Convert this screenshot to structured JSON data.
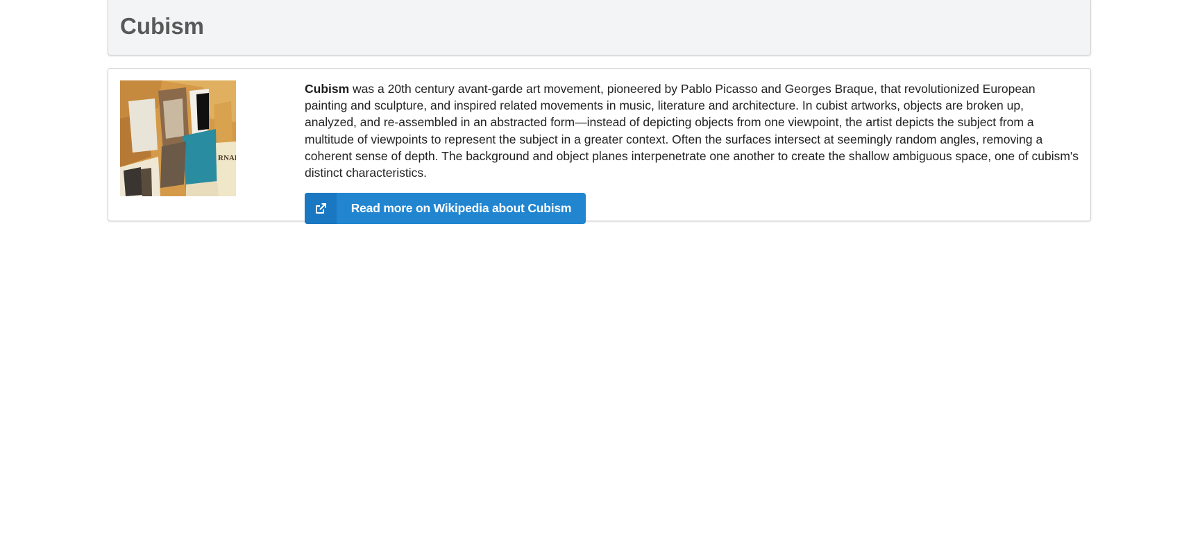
{
  "header": {
    "title": "Cubism"
  },
  "article": {
    "term": "Cubism",
    "description": " was a 20th century avant-garde art movement, pioneered by Pablo Picasso and Georges Braque, that revolutionized European painting and sculpture, and inspired related movements in music, literature and architecture. In cubist artworks, objects are broken up, analyzed, and re-assembled in an abstracted form—instead of depicting objects from one viewpoint, the artist depicts the subject from a multitude of viewpoints to represent the subject in a greater context. Often the surfaces intersect at seemingly random angles, removing a coherent sense of depth. The background and object planes interpenetrate one another to create the shallow ambiguous space, one of cubism's distinct characteristics.",
    "thumbnail_text": "RNAL",
    "button_label": "Read more on Wikipedia about Cubism",
    "button_icon": "external-link-icon"
  },
  "colors": {
    "button": "#2185d0",
    "header_bg": "#f3f4f5",
    "title": "#595959"
  }
}
